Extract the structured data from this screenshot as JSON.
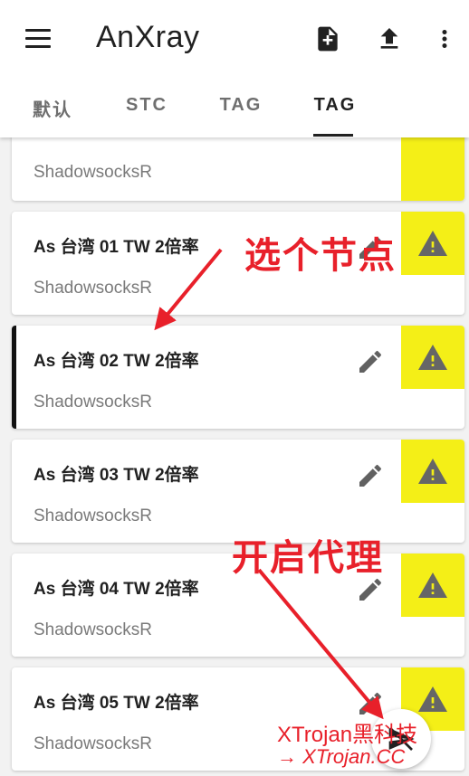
{
  "app": {
    "title": "AnXray"
  },
  "toolbar": {
    "menu_icon": "menu-icon",
    "add_icon": "add-file-icon",
    "upload_icon": "upload-icon",
    "more_icon": "more-vert-icon"
  },
  "tabs": [
    {
      "label": "默认"
    },
    {
      "label": "STC"
    },
    {
      "label": "TAG"
    },
    {
      "label": "TAG",
      "active": true
    }
  ],
  "partial_card": {
    "subtitle": "ShadowsocksR"
  },
  "servers": [
    {
      "name": "As 台湾 01 TW 2倍率",
      "type": "ShadowsocksR",
      "selected": false
    },
    {
      "name": "As 台湾 02 TW 2倍率",
      "type": "ShadowsocksR",
      "selected": true
    },
    {
      "name": "As 台湾 03 TW 2倍率",
      "type": "ShadowsocksR",
      "selected": false
    },
    {
      "name": "As 台湾 04 TW 2倍率",
      "type": "ShadowsocksR",
      "selected": false
    },
    {
      "name": "As 台湾 05 TW 2倍率",
      "type": "ShadowsocksR",
      "selected": false
    }
  ],
  "annotations": {
    "select_node": "选个节点",
    "start_proxy": "开启代理"
  },
  "watermark": {
    "line1": "XTrojan黑科技",
    "line2": "→ XTrojan.CC"
  },
  "colors": {
    "warning_bg": "#f4ef17",
    "annotation": "#e8202a",
    "selected_bar": "#111111"
  }
}
